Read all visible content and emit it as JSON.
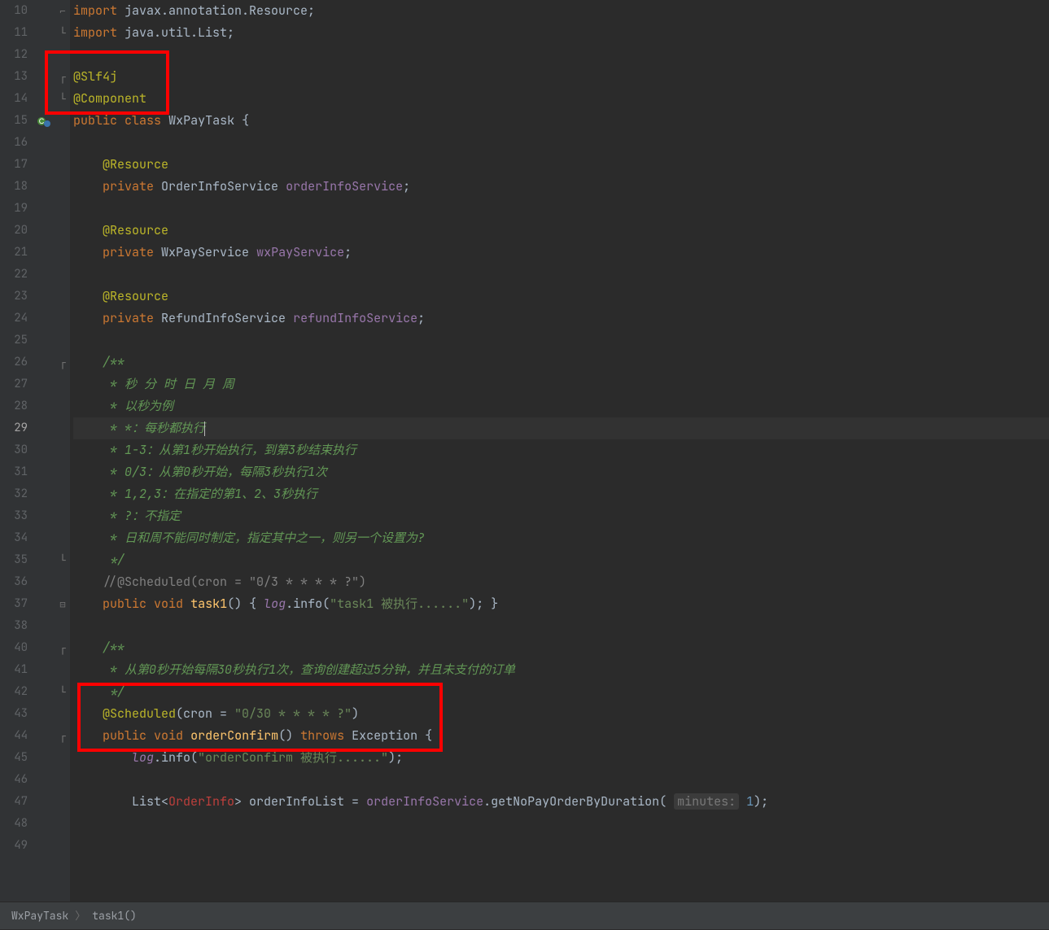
{
  "breadcrumb": {
    "class": "WxPayTask",
    "method": "task1()"
  },
  "gutter": {
    "lines": [
      "10",
      "11",
      "12",
      "13",
      "14",
      "15",
      "16",
      "17",
      "18",
      "19",
      "20",
      "21",
      "22",
      "23",
      "24",
      "25",
      "26",
      "27",
      "28",
      "29",
      "30",
      "31",
      "32",
      "33",
      "34",
      "35",
      "36",
      "37",
      "38",
      "39",
      "40",
      "41",
      "42",
      "43",
      "44",
      "45",
      "46",
      "47",
      "48",
      "49"
    ],
    "current": "29"
  },
  "code": {
    "l10": {
      "kw": "import",
      "pkg": "javax.annotation.Resource;"
    },
    "l11": {
      "kw": "import",
      "pkg": "java.util.List;"
    },
    "l13": {
      "ann": "@Slf4j"
    },
    "l14": {
      "ann": "@Component"
    },
    "l15": {
      "pub": "public",
      "cls": "class",
      "name": "WxPayTask",
      "br": "{"
    },
    "l17": {
      "ann": "@Resource"
    },
    "l18": {
      "priv": "private",
      "type": "OrderInfoService",
      "field": "orderInfoService",
      "sc": ";"
    },
    "l20": {
      "ann": "@Resource"
    },
    "l21": {
      "priv": "private",
      "type": "WxPayService",
      "field": "wxPayService",
      "sc": ";"
    },
    "l23": {
      "ann": "@Resource"
    },
    "l24": {
      "priv": "private",
      "type": "RefundInfoService",
      "field": "refundInfoService",
      "sc": ";"
    },
    "l26": {
      "doc": "/**"
    },
    "l27": {
      "doc": " * 秒 分 时 日 月 周"
    },
    "l28": {
      "doc": " * 以秒为例"
    },
    "l29": {
      "doc": " * *：每秒都执行"
    },
    "l30": {
      "doc": " * 1-3：从第1秒开始执行，到第3秒结束执行"
    },
    "l31": {
      "doc": " * 0/3：从第0秒开始，每隔3秒执行1次"
    },
    "l32": {
      "doc": " * 1,2,3：在指定的第1、2、3秒执行"
    },
    "l33": {
      "doc": " * ?：不指定"
    },
    "l34": {
      "doc": " * 日和周不能同时制定，指定其中之一，则另一个设置为?"
    },
    "l35": {
      "doc": " */"
    },
    "l36": {
      "cmt": "//@Scheduled(cron = \"0/3 * * * * ?\")"
    },
    "l37": {
      "pub": "public",
      "void": "void",
      "name": "task1",
      "p": "() ",
      "ob": "{",
      "log": "log",
      "call": ".info(",
      "str": "\"task1 被执行......\"",
      "end": ");",
      "cb": " }"
    },
    "l41": {
      "doc": "/**"
    },
    "l42": {
      "doc": " * 从第0秒开始每隔30秒执行1次，查询创建超过5分钟，并且未支付的订单"
    },
    "l43": {
      "doc": " */"
    },
    "l44": {
      "ann": "@Scheduled",
      "args_open": "(cron = ",
      "str": "\"0/30 * * * * ?\"",
      "args_close": ")"
    },
    "l45": {
      "pub": "public",
      "void": "void",
      "name": "orderConfirm",
      "p": "() ",
      "throws": "throws",
      "exc": "Exception",
      "ob": " {"
    },
    "l46": {
      "log": "log",
      "call": ".info(",
      "str": "\"orderConfirm 被执行......\"",
      "end": ");"
    },
    "l48": {
      "type": "List<",
      "err": "OrderInfo",
      "type2": "> orderInfoList = ",
      "field": "orderInfoService",
      "call": ".getNoPayOrderByDuration( ",
      "hint": "minutes:",
      "num": " 1",
      "end": ");"
    }
  }
}
